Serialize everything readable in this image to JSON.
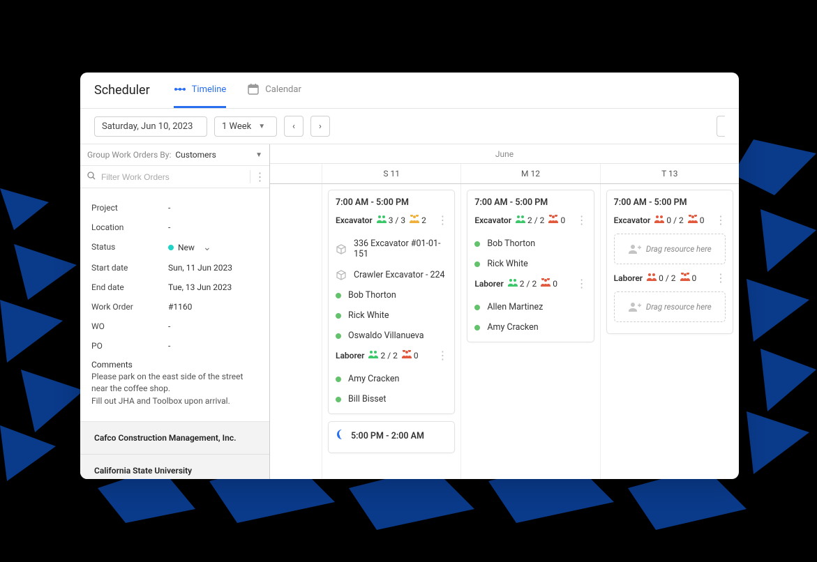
{
  "header": {
    "title": "Scheduler",
    "tabs": [
      {
        "label": "Timeline",
        "active": true
      },
      {
        "label": "Calendar",
        "active": false
      }
    ]
  },
  "filter": {
    "date_label": "Saturday, Jun 10, 2023",
    "range_label": "1 Week"
  },
  "sidebar": {
    "groupby_label": "Group Work Orders By:",
    "groupby_value": "Customers",
    "search_placeholder": "Filter Work Orders",
    "details": [
      {
        "label": "Project",
        "value": "-"
      },
      {
        "label": "Location",
        "value": "-"
      },
      {
        "label": "Status",
        "value": "New",
        "status": true,
        "caret": true
      },
      {
        "label": "Start date",
        "value": "Sun, 11 Jun 2023"
      },
      {
        "label": "End date",
        "value": "Tue, 13 Jun 2023"
      },
      {
        "label": "Work Order",
        "value": "#1160"
      },
      {
        "label": "WO",
        "value": "-"
      },
      {
        "label": "PO",
        "value": "-"
      }
    ],
    "comments_label": "Comments",
    "comments_body": "Please park on the east side of the street near the coffee shop.\nFill out JHA and Toolbox upon arrival.",
    "customers": [
      "Cafco Construction Management, Inc.",
      "California State University"
    ]
  },
  "calendar": {
    "month": "June",
    "days": [
      "",
      "S 11",
      "M 12",
      "T 13"
    ]
  },
  "columns": [
    {
      "empty": true
    },
    {
      "cards": [
        {
          "time": "7:00 AM - 5:00 PM",
          "groups": [
            {
              "role": "Excavator",
              "people": "3 / 3",
              "equip": "2",
              "people_red": false,
              "equip_red": false,
              "resources": [
                {
                  "kind": "equip",
                  "text": "336 Excavator #01-01-151"
                },
                {
                  "kind": "equip",
                  "text": "Crawler Excavator - 224"
                },
                {
                  "kind": "person",
                  "text": "Bob Thorton"
                },
                {
                  "kind": "person",
                  "text": "Rick White"
                },
                {
                  "kind": "person",
                  "text": "Oswaldo Villanueva"
                }
              ]
            },
            {
              "role": "Laborer",
              "people": "2 / 2",
              "equip": "0",
              "people_red": false,
              "equip_red": true,
              "resources": [
                {
                  "kind": "person",
                  "text": "Amy Cracken"
                },
                {
                  "kind": "person",
                  "text": "Bill Bisset"
                }
              ]
            }
          ]
        },
        {
          "time": "5:00 PM - 2:00 AM",
          "night": true,
          "groups": []
        }
      ]
    },
    {
      "cards": [
        {
          "time": "7:00 AM - 5:00 PM",
          "groups": [
            {
              "role": "Excavator",
              "people": "2 / 2",
              "equip": "0",
              "people_red": false,
              "equip_red": true,
              "resources": [
                {
                  "kind": "person",
                  "text": "Bob Thorton"
                },
                {
                  "kind": "person",
                  "text": "Rick White"
                }
              ]
            },
            {
              "role": "Laborer",
              "people": "2 / 2",
              "equip": "0",
              "people_red": false,
              "equip_red": true,
              "resources": [
                {
                  "kind": "person",
                  "text": "Allen Martinez"
                },
                {
                  "kind": "person",
                  "text": "Amy Cracken"
                }
              ]
            }
          ]
        }
      ]
    },
    {
      "cards": [
        {
          "time": "7:00 AM - 5:00 PM",
          "groups": [
            {
              "role": "Excavator",
              "people": "0 / 2",
              "equip": "0",
              "people_red": true,
              "equip_red": true,
              "dropzone": "Drag resource here"
            },
            {
              "role": "Laborer",
              "people": "0 / 2",
              "equip": "0",
              "people_red": true,
              "equip_red": true,
              "dropzone": "Drag resource here"
            }
          ]
        }
      ]
    }
  ]
}
